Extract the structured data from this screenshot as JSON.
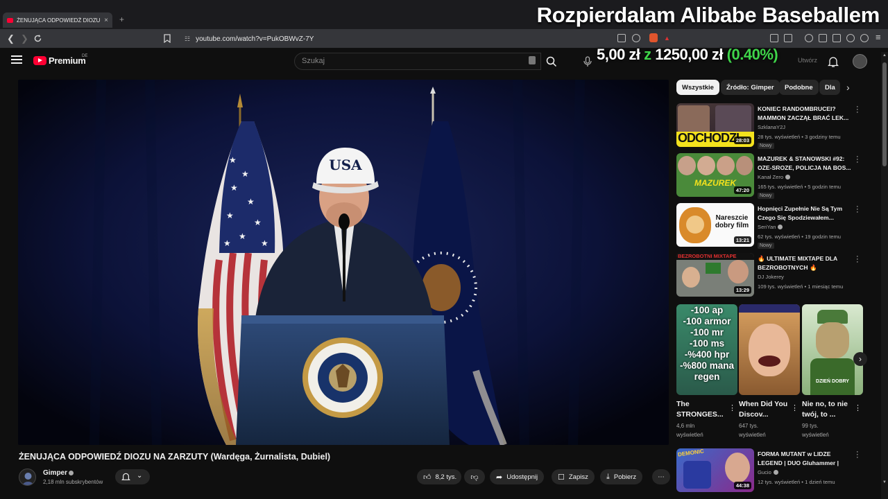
{
  "browser": {
    "tab_title": "ŻENUJĄCA ODPOWIEDŹ DIOZU",
    "tab_close": "×",
    "new_tab": "+",
    "url": "youtube.com/watch?v=PukOBWvZ-7Y"
  },
  "stream_overlay": {
    "title": "Rozpierdalam Alibabe Baseballem",
    "donation_current": "5,00 zł",
    "donation_z": "z",
    "donation_goal": "1250,00 zł",
    "donation_pct": "(0.40%)"
  },
  "youtube": {
    "logo_text": "Premium",
    "country_code": "DE",
    "search_placeholder": "Szukaj",
    "create_hint": "Utwórz"
  },
  "video": {
    "title": "ŻENUJĄCA ODPOWIEDŹ DIOZU NA ZARZUTY (Wardęga, Żurnalista, Dubiel)",
    "channel": "Gimper",
    "subscribers": "2,18 mln subskrybentów",
    "likes": "8,2 tys.",
    "share_label": "Udostępnij",
    "save_label": "Zapisz",
    "download_label": "Pobierz",
    "hat_text": "USA"
  },
  "chips": [
    "Wszystkie",
    "Źródło: Gimper",
    "Podobne",
    "Dla"
  ],
  "recommendations": [
    {
      "title": "KONIEC RANDOMBRUCEI? MAMMON ZACZĄŁ BRAĆ LEK...",
      "channel": "SzklanaY2J",
      "views": "28 tys. wyświetleń • 3 godziny temu",
      "badge": "Nowy",
      "duration": "28:03",
      "thumb_text": "ODCHODZI"
    },
    {
      "title": "MAZUREK & STANOWSKI #92: OZE-SROZE, POLICJA NA BOS...",
      "channel": "Kanał Zero",
      "views": "165 tys. wyświetleń • 5 godzin temu",
      "badge": "Nowy",
      "duration": "47:20",
      "thumb_text": "MAZUREK"
    },
    {
      "title": "Hopnięci Zupełnie Nie Są Tym Czego Się Spodziewałem...",
      "channel": "SeriYan",
      "views": "62 tys. wyświetleń • 19 godzin temu",
      "badge": "Nowy",
      "duration": "13:21",
      "thumb_text": "Nareszcie dobry film"
    },
    {
      "title": "🔥 ULTIMATE MIXTAPE DLA BEZROBOTNYCH 🔥",
      "channel": "DJ Jokerey",
      "views": "109 tys. wyświetleń • 1 miesiąc temu",
      "badge": "",
      "duration": "13:29",
      "thumb_text": "BEZROBOTNI MIXTAPE"
    },
    {
      "title": "FORMA MUTANT w LIDZE LEGEND | DUO Gluhammer |",
      "channel": "Gucio",
      "views": "12 tys. wyświetleń • 1 dzień temu",
      "badge": "",
      "duration": "44:38",
      "thumb_text": "DEMONIC"
    }
  ],
  "shorts": [
    {
      "title": "The STRONGES...",
      "views1": "4,6 mln",
      "views2": "wyświetleń",
      "thumb_lines": [
        "-100 ap",
        "-100 armor",
        "-100 mr",
        "-100 ms",
        "-%400 hpr",
        "-%800 mana",
        "regen"
      ]
    },
    {
      "title": "When Did You Discov...",
      "views1": "647 tys.",
      "views2": "wyświetleń",
      "thumb_lines": []
    },
    {
      "title": "Nie no, to nie twój, to ...",
      "views1": "99 tys.",
      "views2": "wyświetleń",
      "thumb_lines": [
        "DZIEŃ DOBRY"
      ]
    }
  ],
  "colors": {
    "yt_red": "#ff0033",
    "donation_green": "#3fd44a",
    "bg": "#0f0f0f"
  }
}
